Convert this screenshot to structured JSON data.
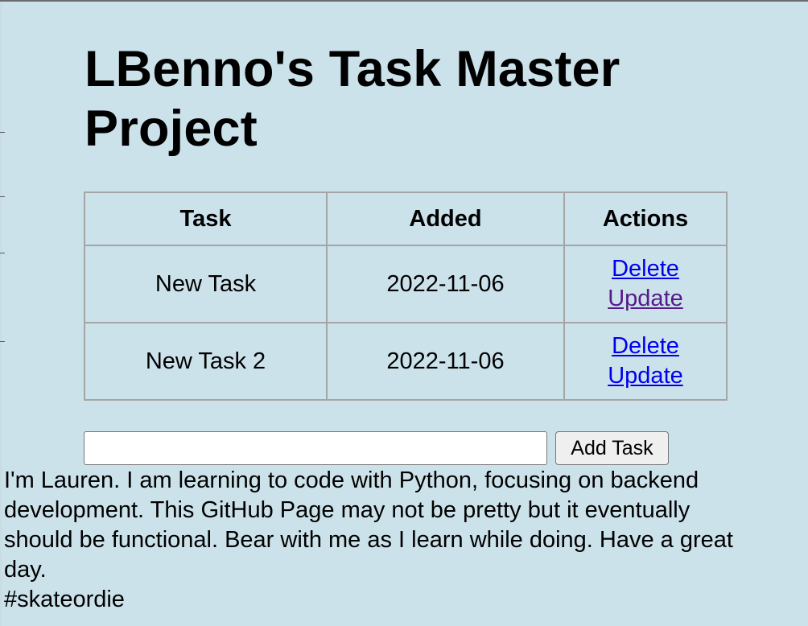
{
  "page": {
    "title": "LBenno's Task Master Project"
  },
  "table": {
    "headers": [
      "Task",
      "Added",
      "Actions"
    ],
    "rows": [
      {
        "task": "New Task",
        "added": "2022-11-06",
        "delete_label": "Delete",
        "update_label": "Update"
      },
      {
        "task": "New Task 2",
        "added": "2022-11-06",
        "delete_label": "Delete",
        "update_label": "Update"
      }
    ]
  },
  "form": {
    "input_value": "",
    "button_label": "Add Task"
  },
  "about": {
    "lines": [
      "I'm Lauren. I am learning to code with Python, focusing on backend",
      "development. This GitHub Page may not be pretty but it eventually",
      "should be functional. Bear with me as I learn while doing. Have a great",
      "day.",
      "#skateordie"
    ]
  },
  "colors": {
    "background": "#cce2ea",
    "link": "#0000ee",
    "visited_link": "#551a8b",
    "table_border": "#a5a5a5"
  }
}
